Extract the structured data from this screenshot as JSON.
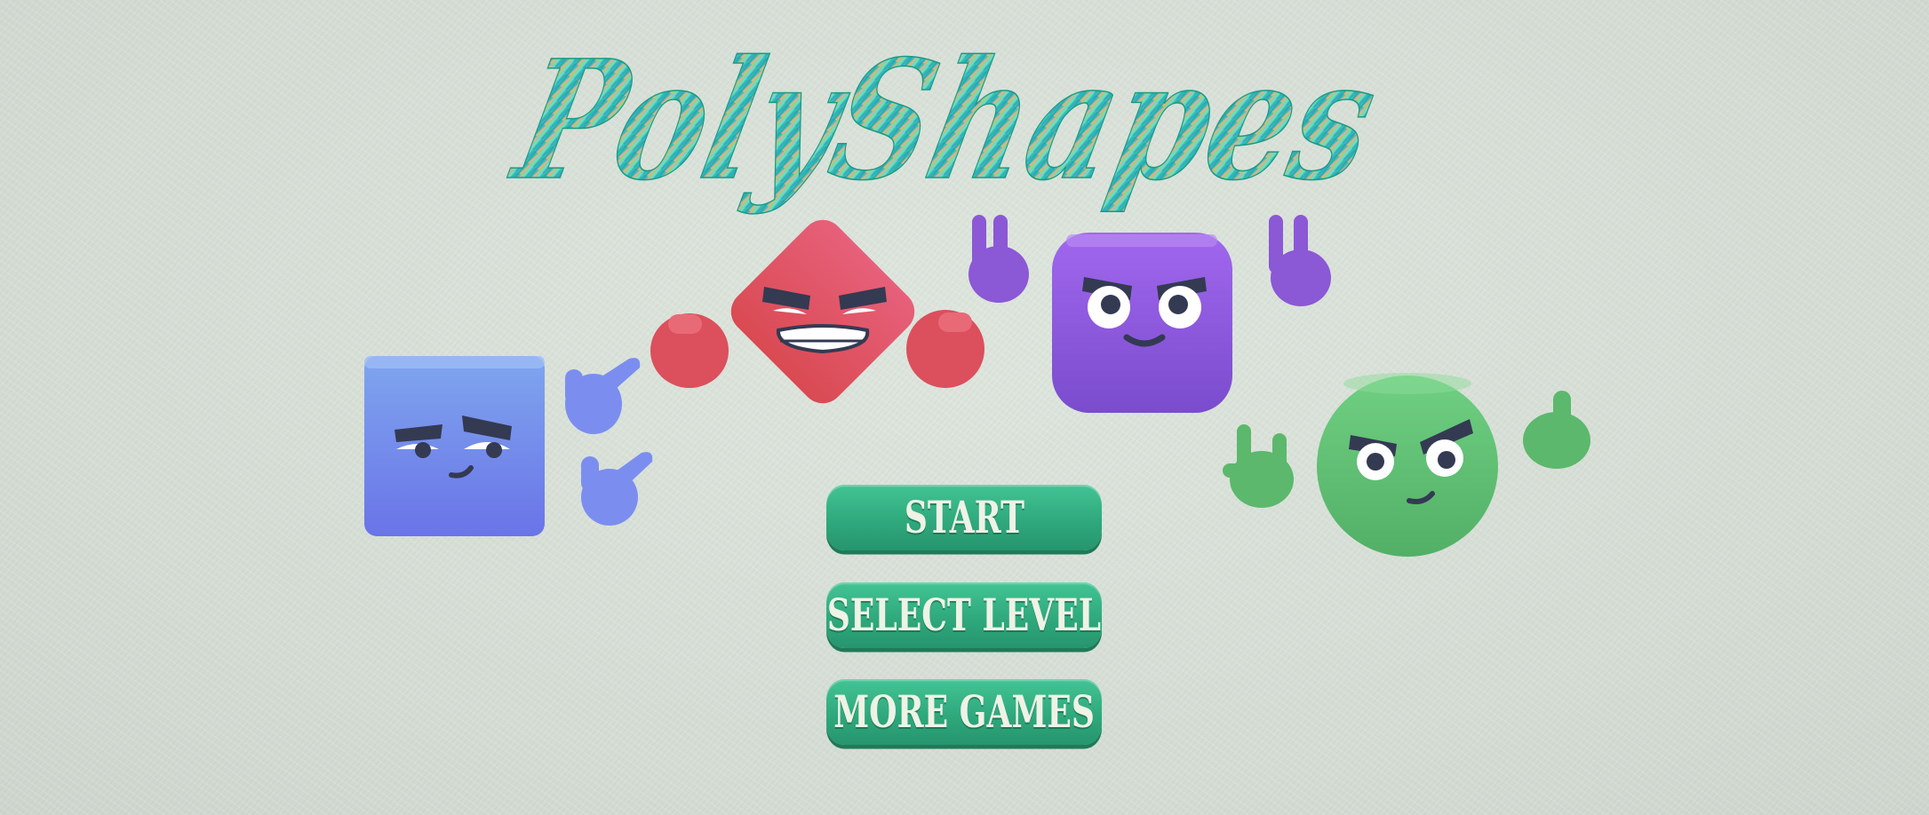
{
  "game": {
    "title": "PolyShapes"
  },
  "menu": {
    "start_label": "START",
    "select_level_label": "SELECT LEVEL",
    "more_games_label": "MORE GAMES"
  },
  "characters": [
    {
      "name": "blue-square-character",
      "shape": "square",
      "color": "#6f86ea",
      "gesture": "pointing-hands-icon"
    },
    {
      "name": "red-diamond-character",
      "shape": "diamond",
      "color": "#e05766",
      "gesture": "fists-icon"
    },
    {
      "name": "purple-square-character",
      "shape": "rounded-square",
      "color": "#8a58dc",
      "gesture": "peace-hands-icon"
    },
    {
      "name": "green-circle-character",
      "shape": "circle",
      "color": "#5dbb70",
      "gesture": "rock-and-thumbs-up-icon"
    }
  ],
  "colors": {
    "background": "#d6ded6",
    "button": "#2fa97d",
    "button_text": "#eef3e6",
    "title_teal": "#2fc49a",
    "title_blue": "#3a9ee0",
    "title_peach": "#f2a98e",
    "face_dark": "#343a52"
  }
}
